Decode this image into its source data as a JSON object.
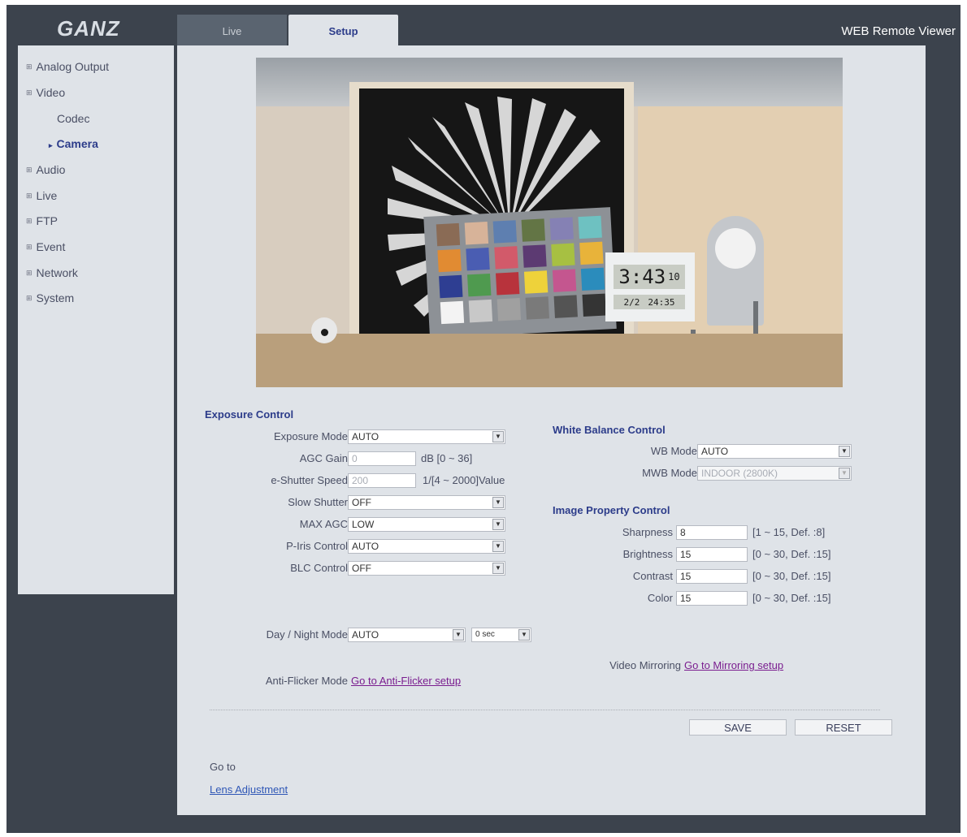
{
  "header": {
    "logo_text": "GANZ",
    "tabs": [
      {
        "label": "Live"
      },
      {
        "label": "Setup"
      }
    ],
    "viewer_title": "WEB Remote Viewer"
  },
  "sidebar": {
    "items": [
      {
        "label": "Analog Output"
      },
      {
        "label": "Video"
      },
      {
        "label": "Codec"
      },
      {
        "label": "Camera"
      },
      {
        "label": "Audio"
      },
      {
        "label": "Live"
      },
      {
        "label": "FTP"
      },
      {
        "label": "Event"
      },
      {
        "label": "Network"
      },
      {
        "label": "System"
      }
    ],
    "active_marker": "▸"
  },
  "preview": {
    "clock_time": "3:43",
    "clock_seconds": "10",
    "clock_date": "2/2",
    "clock_small": "24:35"
  },
  "exposure": {
    "title": "Exposure Control",
    "mode": {
      "label": "Exposure Mode",
      "value": "AUTO"
    },
    "agc_gain": {
      "label": "AGC Gain",
      "value": "0",
      "hint": "dB [0 ~ 36]"
    },
    "shutter": {
      "label": "e-Shutter Speed",
      "value": "200",
      "hint": "1/[4 ~ 2000]Value"
    },
    "slow_shutter": {
      "label": "Slow Shutter",
      "value": "OFF"
    },
    "max_agc": {
      "label": "MAX AGC",
      "value": "LOW"
    },
    "p_iris": {
      "label": "P-Iris Control",
      "value": "AUTO"
    },
    "blc": {
      "label": "BLC Control",
      "value": "OFF"
    }
  },
  "white_balance": {
    "title": "White Balance Control",
    "wb_mode": {
      "label": "WB Mode",
      "value": "AUTO"
    },
    "mwb_mode": {
      "label": "MWB Mode",
      "value": "INDOOR (2800K)"
    }
  },
  "image_property": {
    "title": "Image Property Control",
    "sharpness": {
      "label": "Sharpness",
      "value": "8",
      "hint": "[1 ~ 15, Def. :8]"
    },
    "brightness": {
      "label": "Brightness",
      "value": "15",
      "hint": "[0 ~ 30, Def. :15]"
    },
    "contrast": {
      "label": "Contrast",
      "value": "15",
      "hint": "[0 ~ 30, Def. :15]"
    },
    "color": {
      "label": "Color",
      "value": "15",
      "hint": "[0 ~ 30, Def. :15]"
    }
  },
  "day_night": {
    "label": "Day / Night Mode",
    "value": "AUTO",
    "delay": "0 sec"
  },
  "anti_flicker": {
    "label": "Anti-Flicker Mode",
    "link": "Go to Anti-Flicker setup"
  },
  "mirroring": {
    "label": "Video Mirroring",
    "link": "Go to Mirroring setup"
  },
  "buttons": {
    "save": "SAVE",
    "reset": "RESET"
  },
  "goto": {
    "label": "Go to",
    "link": "Lens Adjustment"
  },
  "colors": {
    "accent": "#2c3c8a",
    "frame": "#3c434d",
    "panel": "#dfe3e8",
    "link": "#7a1d8f"
  }
}
